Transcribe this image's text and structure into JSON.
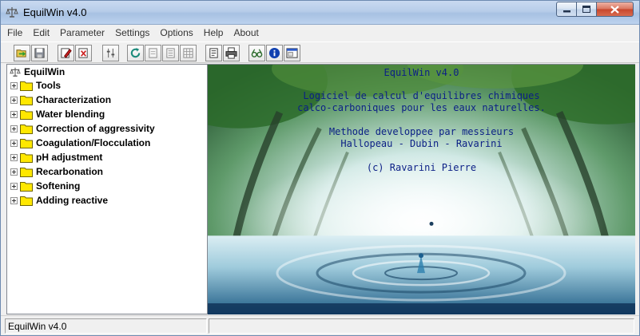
{
  "window": {
    "title": "EquilWin v4.0"
  },
  "menu": [
    "File",
    "Edit",
    "Parameter",
    "Settings",
    "Options",
    "Help",
    "About"
  ],
  "toolbar_icons": [
    "open-folder-icon",
    "save-icon",
    "edit-icon",
    "delete-icon",
    "adjust-icon",
    "refresh-icon",
    "page-icon",
    "list-icon",
    "grid-icon",
    "document-icon",
    "print-icon",
    "glasses-icon",
    "info-icon",
    "window-icon"
  ],
  "tree": {
    "root": "EquilWin",
    "items": [
      "Tools",
      "Characterization",
      "Water blending",
      "Correction of aggressivity",
      "Coagulation/Flocculation",
      "pH adjustment",
      "Recarbonation",
      "Softening",
      "Adding reactive"
    ]
  },
  "splash": {
    "line1": "EquilWin v4.0",
    "line2": "Logiciel de calcul d'equilibres chimiques",
    "line3": "calco-carboniques pour les eaux naturelles.",
    "line4": "Methode developpee par messieurs",
    "line5": "Hallopeau - Dubin - Ravarini",
    "line6": "(c) Ravarini Pierre"
  },
  "status": {
    "text": "EquilWin v4.0"
  },
  "colors": {
    "splash_text": "#0b1f86",
    "folder": "#ffe800"
  }
}
